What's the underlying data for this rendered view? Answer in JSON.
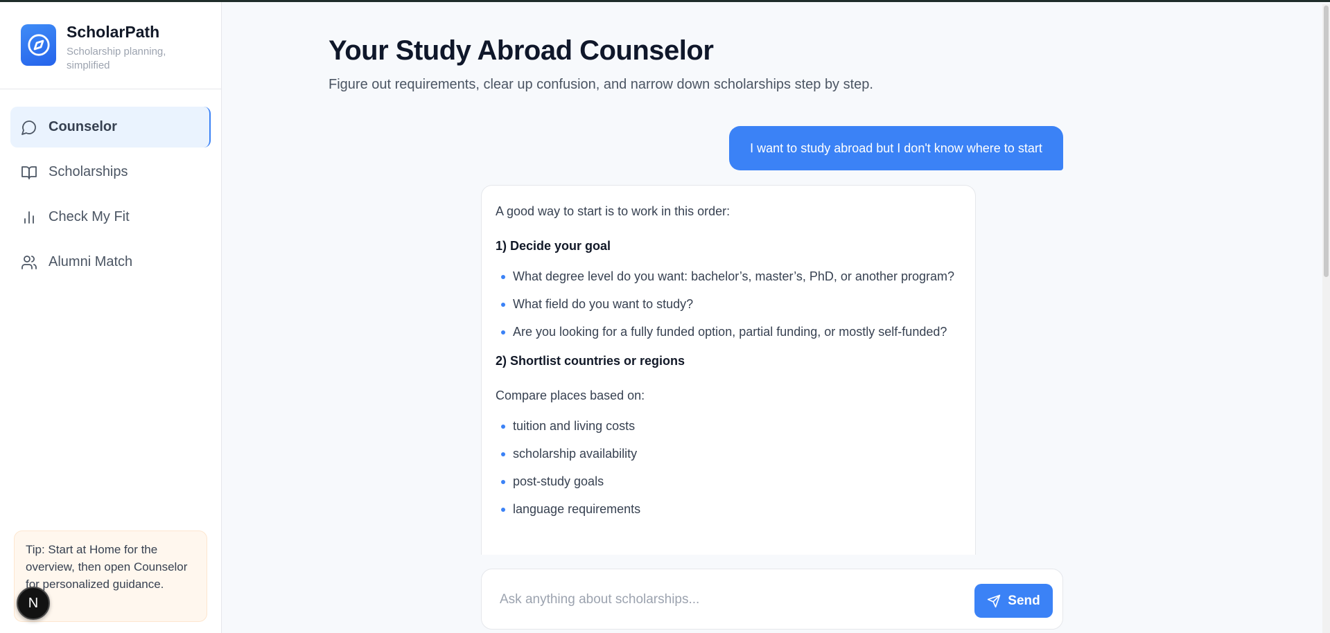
{
  "brand": {
    "name": "ScholarPath",
    "tagline": "Scholarship planning, simplified"
  },
  "nav": [
    {
      "label": "Counselor",
      "icon": "chat-bubble-icon",
      "active": true
    },
    {
      "label": "Scholarships",
      "icon": "book-open-icon",
      "active": false
    },
    {
      "label": "Check My Fit",
      "icon": "bar-chart-icon",
      "active": false
    },
    {
      "label": "Alumni Match",
      "icon": "users-icon",
      "active": false
    }
  ],
  "tip": "Tip: Start at Home for the overview, then open Counselor for personalized guidance.",
  "badge": "N",
  "page": {
    "title": "Your Study Abroad Counselor",
    "subtitle": "Figure out requirements, clear up confusion, and narrow down scholarships step by step."
  },
  "chat": {
    "user_message": "I want to study abroad but I don't know where to start",
    "assistant": {
      "intro": "A good way to start is to work in this order:",
      "section1_title": "1) Decide your goal",
      "section1_items": [
        "What degree level do you want: bachelor’s, master’s, PhD, or another program?",
        "What field do you want to study?",
        "Are you looking for a fully funded option, partial funding, or mostly self-funded?"
      ],
      "section2_title": "2) Shortlist countries or regions",
      "section2_intro": "Compare places based on:",
      "section2_items": [
        "tuition and living costs",
        "scholarship availability",
        "post-study goals",
        "language requirements"
      ]
    }
  },
  "composer": {
    "placeholder": "Ask anything about scholarships...",
    "value": "",
    "send_label": "Send"
  },
  "colors": {
    "accent": "#3b82f6",
    "tip_bg": "#fff7ee",
    "page_bg": "#f7f9fc"
  }
}
